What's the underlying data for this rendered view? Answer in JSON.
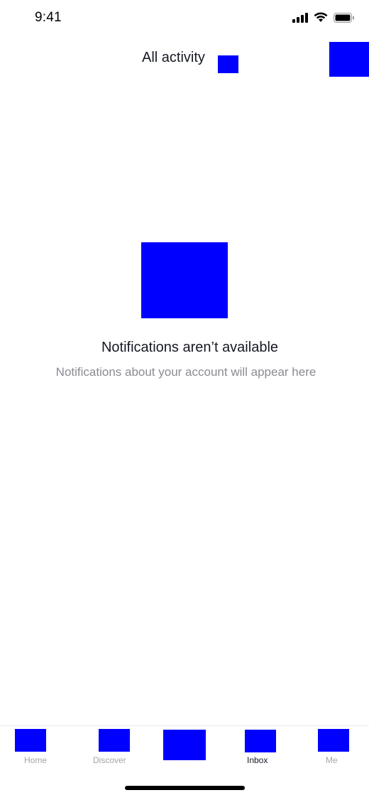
{
  "status_bar": {
    "time": "9:41",
    "icons": [
      "cellular-signal-icon",
      "wifi-icon",
      "battery-icon"
    ]
  },
  "header": {
    "title": "All activity",
    "dropdown_icon": "chevron-down-icon",
    "action_icon": "direct-message-icon"
  },
  "empty_state": {
    "illustration_icon": "notification-illustration-icon",
    "title": "Notifications aren’t available",
    "subtitle": "Notifications about your account will appear here"
  },
  "tab_bar": {
    "tabs": [
      {
        "label": "Home",
        "icon": "home-icon",
        "active": false
      },
      {
        "label": "Discover",
        "icon": "discover-icon",
        "active": false
      },
      {
        "label": "",
        "icon": "create-icon",
        "active": false
      },
      {
        "label": "Inbox",
        "icon": "inbox-icon",
        "active": true
      },
      {
        "label": "Me",
        "icon": "profile-icon",
        "active": false
      }
    ]
  },
  "colors": {
    "placeholder": "#0000ff",
    "text_primary": "#161823",
    "text_secondary": "#8a8b91",
    "tab_inactive": "#a3a4a8"
  }
}
